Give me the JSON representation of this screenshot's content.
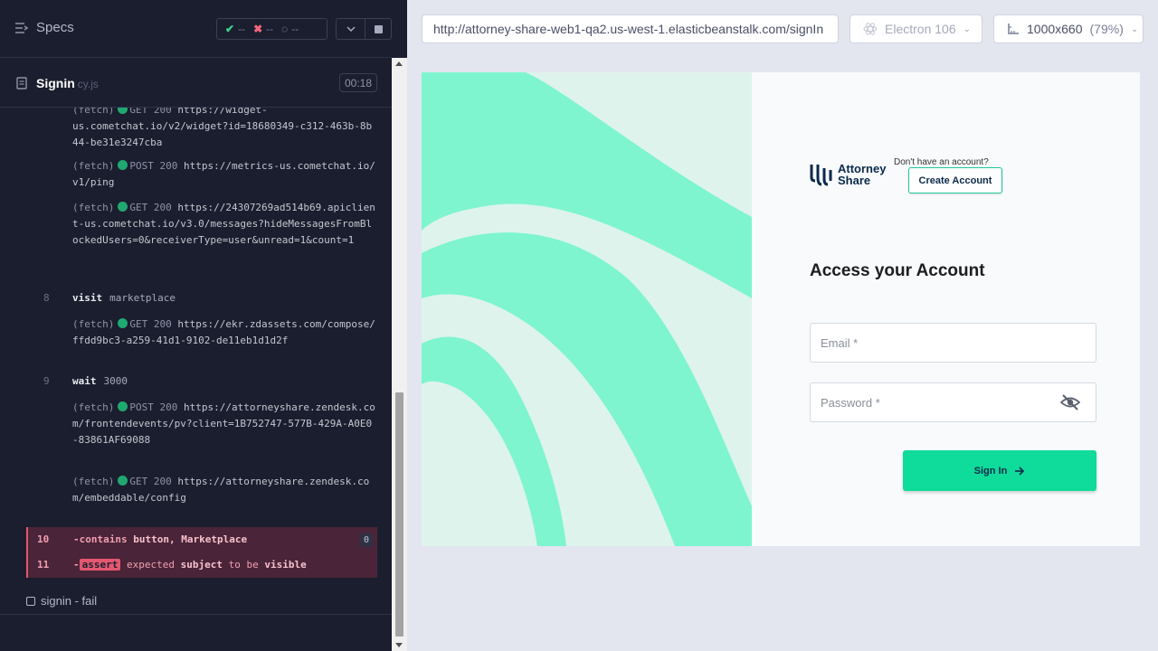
{
  "runner": {
    "specs_label": "Specs",
    "stats": {
      "passed": "--",
      "failed": "--",
      "pending": "--"
    },
    "spec_file": {
      "name": "Signin",
      "ext": "cy.js"
    },
    "timer": "00:18",
    "commands": [
      {
        "name": "(fetch)",
        "method": "GET 200",
        "url": "https://widget-us.cometchat.io/v2/widget?id=18680349-c312-463b-8b44-be31e3247cba",
        "url_visible": "us.cometchat.io/v2/widget?id=18680349-c312-463b-8b44-be31e3247cba"
      },
      {
        "name": "(fetch)",
        "method": "POST 200",
        "url": "https://metrics-us.cometchat.io/v1/ping"
      },
      {
        "name": "(fetch)",
        "method": "GET 200",
        "url": "https://24307269ad514b69.apiclient-us.cometchat.io/v3.0/messages?hideMessagesFromBlockedUsers=0&receiverType=user&unread=1&count=1"
      },
      {
        "num": "8",
        "command": "visit",
        "arg": "marketplace"
      },
      {
        "name": "(fetch)",
        "method": "GET 200",
        "url": "https://ekr.zdassets.com/compose/ffdd9bc3-a259-41d1-9102-de11eb1d1d2f"
      },
      {
        "num": "9",
        "command": "wait",
        "arg": "3000"
      },
      {
        "name": "(fetch)",
        "method": "POST 200",
        "url": "https://attorneyshare.zendesk.com/frontendevents/pv?client=1B752747-577B-429A-A0E0-83861AF69088"
      },
      {
        "name": "(fetch)",
        "method": "GET 200",
        "url": "https://attorneyshare.zendesk.com/embeddable/config"
      }
    ],
    "failed": [
      {
        "num": "10",
        "command": "-contains",
        "arg": "button, Marketplace",
        "badge": "0"
      },
      {
        "num": "11",
        "command": "-",
        "assert_label": "assert",
        "parts": [
          "expected",
          "subject",
          "to be",
          "visible"
        ]
      }
    ],
    "test_title": "signin - fail"
  },
  "browser": {
    "url": "http://attorney-share-web1-qa2.us-west-1.elasticbeanstalk.com/signIn",
    "browser_name": "Electron 106",
    "viewport": "1000x660",
    "zoom": "(79%)"
  },
  "app": {
    "logo_text_1": "Attorney",
    "logo_text_2": "Share",
    "no_account_text": "Don't have an account?",
    "create_account_label": "Create Account",
    "heading": "Access your Account",
    "email_placeholder": "Email *",
    "password_placeholder": "Password *",
    "sign_in_label": "Sign In",
    "colors": {
      "accent": "#0fdb9a",
      "art_light": "#def3ec",
      "art_stripe": "#7ef5cf",
      "navy": "#0b2a4a"
    }
  }
}
